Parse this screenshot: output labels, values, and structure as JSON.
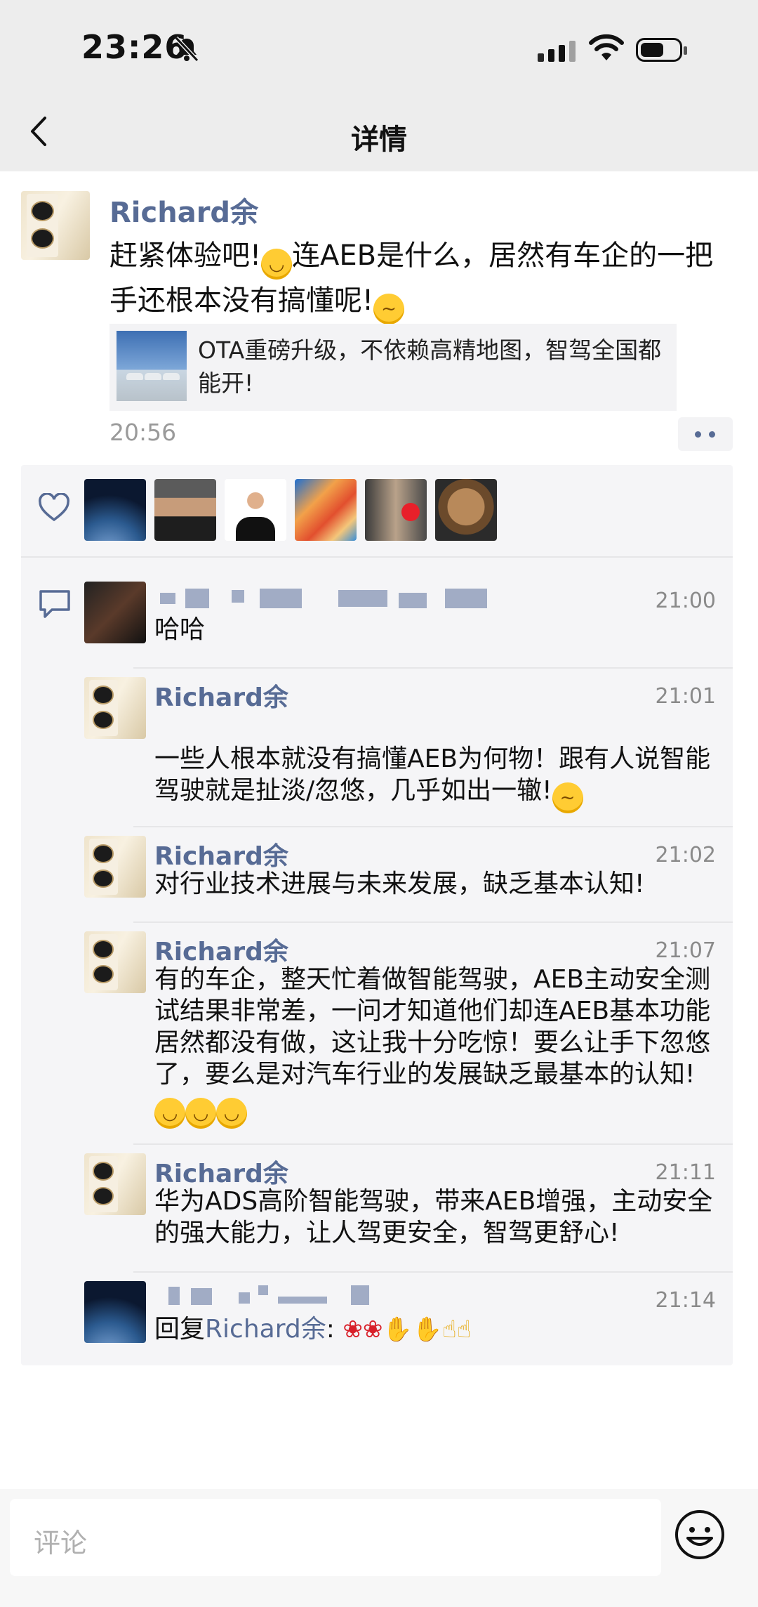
{
  "status_bar": {
    "time": "23:26"
  },
  "nav": {
    "title": "详情"
  },
  "post": {
    "author": "Richard余",
    "text_part1": "赶紧体验吧!",
    "text_part2": "连AEB是什么，居然有车企的一把手还根本没有搞懂呢!",
    "link_title": "OTA重磅升级，不依赖高精地图，智驾全国都能开!",
    "time": "20:56"
  },
  "comments": [
    {
      "name": "",
      "time": "21:00",
      "text": "哈哈"
    },
    {
      "name": "Richard余",
      "time": "21:01",
      "text": "一些人根本就没有搞懂AEB为何物！跟有人说智能驾驶就是扯淡/忽悠，几乎如出一辙!"
    },
    {
      "name": "Richard余",
      "time": "21:02",
      "text": "对行业技术进展与未来发展，缺乏基本认知!"
    },
    {
      "name": "Richard余",
      "time": "21:07",
      "text": "有的车企，整天忙着做智能驾驶，AEB主动安全测试结果非常差，一问才知道他们却连AEB基本功能居然都没有做，这让我十分吃惊！要么让手下忽悠了，要么是对汽车行业的发展缺乏最基本的认知!"
    },
    {
      "name": "Richard余",
      "time": "21:11",
      "text": "华为ADS高阶智能驾驶，带来AEB增强，主动安全的强大能力，让人驾更安全，智驾更舒心!"
    },
    {
      "name": "",
      "time": "21:14",
      "reply_prefix": "回复",
      "reply_to": "Richard余",
      "reply_colon": ":"
    }
  ],
  "bottom_bar": {
    "comment_placeholder": "评论"
  },
  "icons": [
    "back-chevron-icon",
    "mute-bell-icon",
    "cellular-signal-icon",
    "wifi-icon",
    "battery-icon",
    "heart-icon",
    "comment-bubble-icon",
    "smiley-icon",
    "grin-emoji",
    "thinking-emoji",
    "rose-emoji",
    "praying-hands-emoji",
    "thumbs-up-emoji"
  ],
  "colors": {
    "name_blue": "#576b95",
    "panel_bg": "#f5f5f7",
    "topbar_bg": "#ededed"
  }
}
